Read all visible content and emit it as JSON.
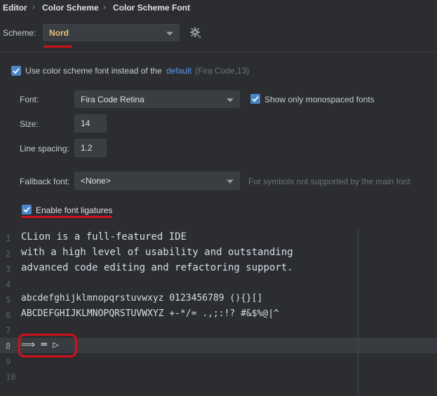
{
  "breadcrumb": {
    "items": [
      "Editor",
      "Color Scheme",
      "Color Scheme Font"
    ],
    "separator": "›"
  },
  "scheme": {
    "label": "Scheme:",
    "value": "Nord",
    "value_color": "#e5c07b",
    "settings_icon": "gear-icon"
  },
  "use_scheme_font": {
    "checked": true,
    "label": "Use color scheme font instead of the",
    "link": "default",
    "suffix": "(Fira Code,13)"
  },
  "font": {
    "label": "Font:",
    "value": "Fira Code Retina",
    "monospaced_checked": true,
    "monospaced_label": "Show only monospaced fonts"
  },
  "size": {
    "label": "Size:",
    "value": "14"
  },
  "line_spacing": {
    "label": "Line spacing:",
    "value": "1.2"
  },
  "fallback": {
    "label": "Fallback font:",
    "value": "<None>",
    "hint": "For symbols not supported by the main font"
  },
  "ligatures": {
    "checked": true,
    "label": "Enable font ligatures"
  },
  "preview": {
    "line_numbers": [
      "1",
      "2",
      "3",
      "4",
      "5",
      "6",
      "7",
      "8",
      "9",
      "10"
    ],
    "lines": [
      "CLion is a full-featured IDE",
      "with a high level of usability and outstanding",
      "advanced code editing and refactoring support.",
      "",
      "abcdefghijklmnopqrstuvwxyz 0123456789 (){}[]",
      "ABCDEFGHIJKLMNOPQRSTUVWXYZ +-*/= .,;:!? #&$%@|^",
      "",
      "⟹ ═ ▷",
      "",
      ""
    ]
  },
  "colors": {
    "background": "#2b2d30",
    "accent": "#4a86c8",
    "link": "#589df6",
    "annotation": "#d1101b"
  }
}
